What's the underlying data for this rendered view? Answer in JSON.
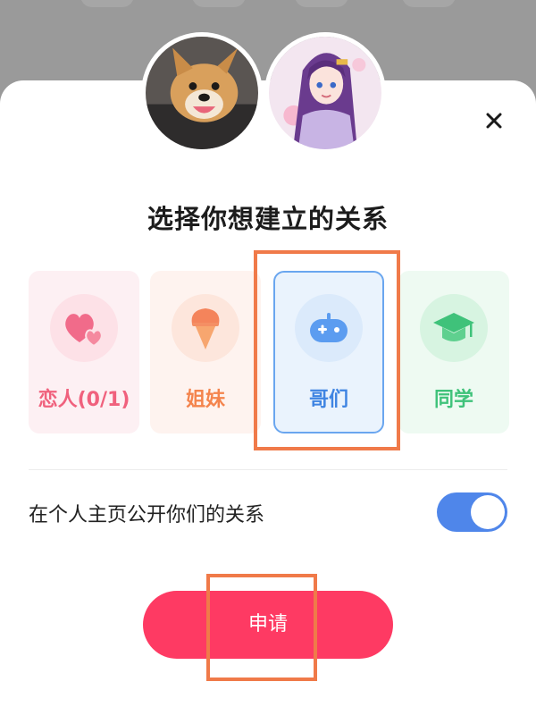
{
  "dialog": {
    "title": "选择你想建立的关系",
    "close_icon": "close-icon"
  },
  "avatars": [
    {
      "name": "dog-avatar",
      "depicts": "corgi-dog-photo"
    },
    {
      "name": "anime-avatar",
      "depicts": "anime-girl-purple-hair"
    }
  ],
  "relationships": [
    {
      "id": "lover",
      "label": "恋人(0/1)",
      "icon": "hearts-icon",
      "color": "#f0617d",
      "selected": false
    },
    {
      "id": "sister",
      "label": "姐妹",
      "icon": "ice-cream-icon",
      "color": "#f4844d",
      "selected": false
    },
    {
      "id": "bro",
      "label": "哥们",
      "icon": "gamepad-icon",
      "color": "#3f84e2",
      "selected": true
    },
    {
      "id": "classmate",
      "label": "同学",
      "icon": "graduation-cap-icon",
      "color": "#3fc27a",
      "selected": false
    }
  ],
  "public_toggle": {
    "label": "在个人主页公开你们的关系",
    "on": true,
    "accent": "#4f86ea"
  },
  "apply_button": {
    "label": "申请",
    "color": "#fe3a63"
  },
  "annotation_color": "#f07a49"
}
